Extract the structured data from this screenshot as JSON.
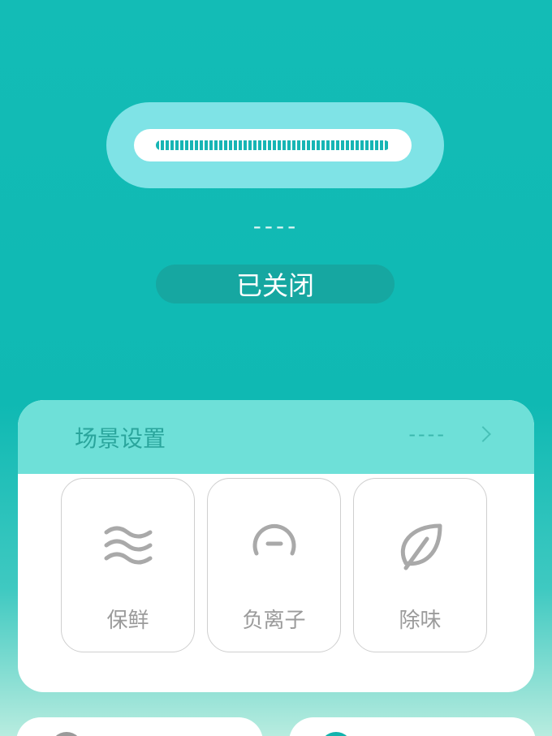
{
  "device": {
    "value_text": "----",
    "status_label": "已关闭"
  },
  "scene": {
    "title": "场景设置",
    "status_text": "----",
    "modes": [
      {
        "label": "保鲜",
        "icon": "waves-icon"
      },
      {
        "label": "负离子",
        "icon": "negative-ion-icon"
      },
      {
        "label": "除味",
        "icon": "leaf-icon"
      }
    ]
  },
  "colors": {
    "accent": "#13bcb6",
    "device_pill": "#7fe3e6",
    "status_pill": "#16a7a1",
    "scene_header": "#6ee0d8"
  }
}
